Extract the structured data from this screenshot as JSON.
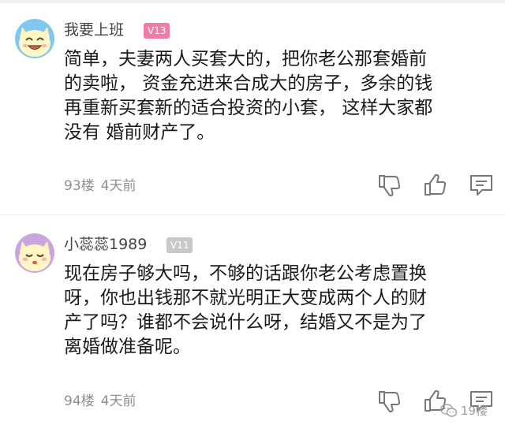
{
  "comments": [
    {
      "username": "我要上班",
      "level": "V13",
      "text_lines": [
        "简单，夫妻两人买套大的，把你老公那套婚前",
        "的卖啦， 资金充进来合成大的房子，多余的钱",
        "再重新买套新的适合投资的小套， 这样大家都",
        "没有 婚前财产了。"
      ],
      "floor": "93楼",
      "time": "4天前",
      "avatar_icon": "cat-avatar-icon",
      "level_color": "#f07aa8"
    },
    {
      "username": "小蕊蕊1989",
      "level": "V11",
      "text_lines": [
        "现在房子够大吗，不够的话跟你老公考虑置换",
        "呀，你也出钱那不就光明正大变成两个人的财",
        "产了吗？谁都不会说什么呀，结婚又不是为了",
        "离婚做准备呢。"
      ],
      "floor": "94楼",
      "time": "4天前",
      "avatar_icon": "cat-avatar-icon",
      "level_color": "#c8c8c8"
    }
  ],
  "actions": {
    "dislike_icon": "thumbs-down-icon",
    "like_icon": "thumbs-up-icon",
    "reply_icon": "comment-icon"
  },
  "watermark": {
    "text": "19楼",
    "icon": "wechat-icon"
  }
}
